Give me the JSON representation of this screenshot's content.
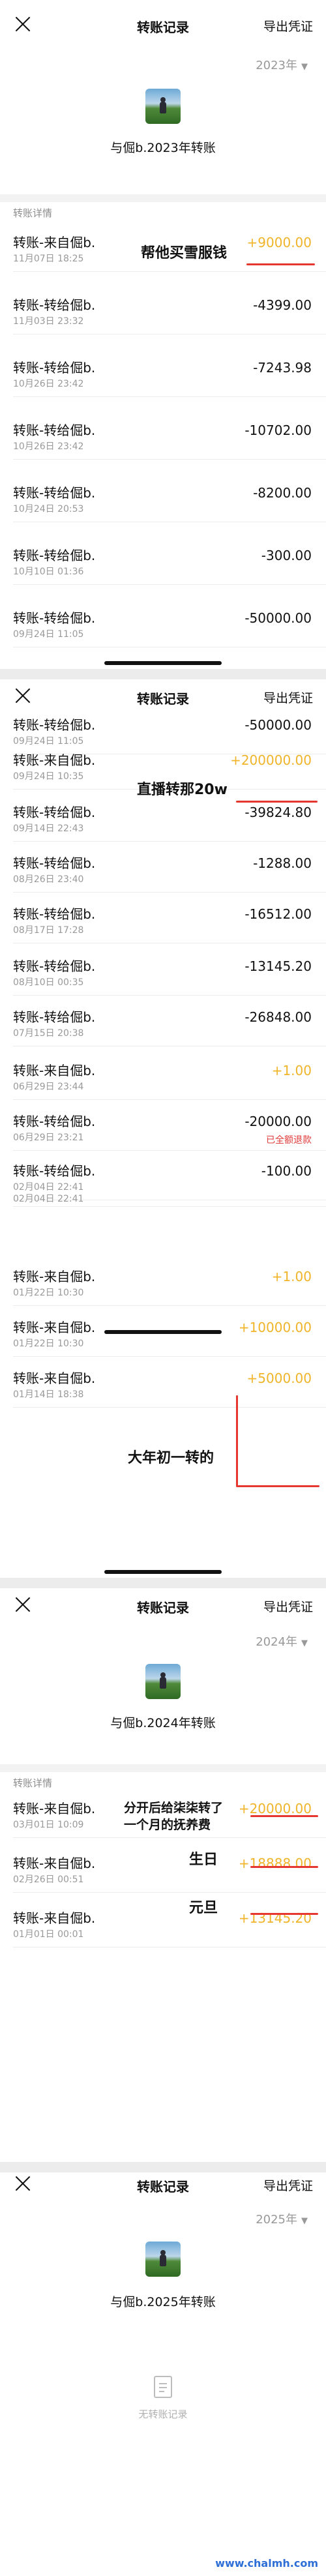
{
  "header": {
    "title": "转账记录",
    "export_label": "导出凭证"
  },
  "section_2023": {
    "year_selector": "2023年",
    "summary": "与倔b.2023年转账",
    "detail_label": "转账详情",
    "rows": [
      {
        "name": "转账-来自倔b.",
        "time": "11月07日 18:25",
        "amount": "+9000.00",
        "direction": "in"
      },
      {
        "name": "转账-转给倔b.",
        "time": "11月03日 23:32",
        "amount": "-4399.00",
        "direction": "out"
      },
      {
        "name": "转账-转给倔b.",
        "time": "10月26日 23:42",
        "amount": "-7243.98",
        "direction": "out"
      },
      {
        "name": "转账-转给倔b.",
        "time": "10月26日 23:42",
        "amount": "-10702.00",
        "direction": "out"
      },
      {
        "name": "转账-转给倔b.",
        "time": "10月24日 20:53",
        "amount": "-8200.00",
        "direction": "out"
      },
      {
        "name": "转账-转给倔b.",
        "time": "10月10日 01:36",
        "amount": "-300.00",
        "direction": "out"
      },
      {
        "name": "转账-转给倔b.",
        "time": "09月24日 11:05",
        "amount": "-50000.00",
        "direction": "out"
      }
    ],
    "annotation": "帮他买雪服钱"
  },
  "section_2023_cont": {
    "rows": [
      {
        "name": "转账-转给倔b.",
        "time": "09月24日 11:05",
        "amount": "-50000.00",
        "direction": "out"
      },
      {
        "name": "转账-来自倔b.",
        "time": "09月24日 10:35",
        "amount": "+200000.00",
        "direction": "in"
      },
      {
        "name": "转账-转给倔b.",
        "time": "09月14日 22:43",
        "amount": "-39824.80",
        "direction": "out"
      },
      {
        "name": "转账-转给倔b.",
        "time": "08月26日 23:40",
        "amount": "-1288.00",
        "direction": "out"
      },
      {
        "name": "转账-转给倔b.",
        "time": "08月17日 17:28",
        "amount": "-16512.00",
        "direction": "out"
      },
      {
        "name": "转账-转给倔b.",
        "time": "08月10日 00:35",
        "amount": "-13145.20",
        "direction": "out"
      },
      {
        "name": "转账-转给倔b.",
        "time": "07月15日 20:38",
        "amount": "-26848.00",
        "direction": "out"
      },
      {
        "name": "转账-来自倔b.",
        "time": "06月29日 23:44",
        "amount": "+1.00",
        "direction": "in"
      },
      {
        "name": "转账-转给倔b.",
        "time": "06月29日 23:21",
        "amount": "-20000.00",
        "direction": "out",
        "note": "已全额退款"
      },
      {
        "name": "转账-转给倔b.",
        "time": "02月04日 22:41",
        "amount": "-100.00",
        "direction": "out"
      },
      {
        "name": "",
        "time": "02月04日 22:41",
        "amount": "",
        "direction": "out"
      },
      {
        "name": "转账-来自倔b.",
        "time": "01月22日 10:30",
        "amount": "+1.00",
        "direction": "in"
      },
      {
        "name": "转账-来自倔b.",
        "time": "01月22日 10:30",
        "amount": "+10000.00",
        "direction": "in"
      },
      {
        "name": "转账-来自倔b.",
        "time": "01月14日 18:38",
        "amount": "+5000.00",
        "direction": "in"
      }
    ],
    "annotation_livestream": "直播转那20w",
    "annotation_newyear": "大年初一转的"
  },
  "section_2024": {
    "year_selector": "2024年",
    "summary": "与倔b.2024年转账",
    "detail_label": "转账详情",
    "rows": [
      {
        "name": "转账-来自倔b.",
        "time": "03月01日 10:09",
        "amount": "+20000.00",
        "direction": "in"
      },
      {
        "name": "转账-来自倔b.",
        "time": "02月26日 00:51",
        "amount": "+18888.00",
        "direction": "in"
      },
      {
        "name": "转账-来自倔b.",
        "time": "01月01日 00:01",
        "amount": "+13145.20",
        "direction": "in"
      }
    ],
    "annotation_breakup_line1": "分开后给柒柒转了",
    "annotation_breakup_line2": "一个月的抚养费",
    "annotation_birthday": "生日",
    "annotation_newyear": "元旦"
  },
  "section_2025": {
    "year_selector": "2025年",
    "summary": "与倔b.2025年转账",
    "empty_text": "无转账记录"
  },
  "watermark": "www.chalmh.com",
  "colors": {
    "income": "#f0b429",
    "annotation_line": "#e5362f",
    "watermark": "#2d6fd6"
  }
}
